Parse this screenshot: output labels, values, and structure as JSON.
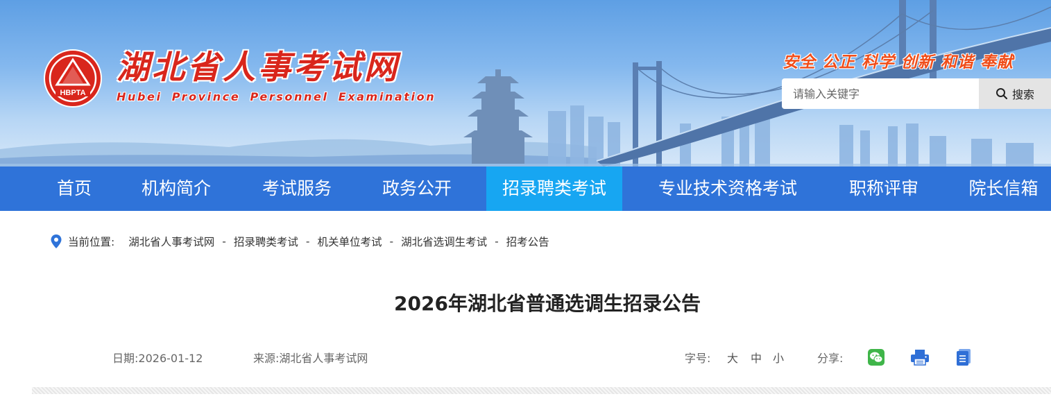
{
  "header": {
    "logo_text": "HBPTA",
    "site_title": "湖北省人事考试网",
    "site_subtitle": "Hubei Province Personnel Examination",
    "slogan": "安全 公正 科学 创新 和谐 奉献"
  },
  "search": {
    "placeholder": "请输入关键字",
    "button_label": "搜索"
  },
  "nav": {
    "items": [
      {
        "label": "首页"
      },
      {
        "label": "机构简介"
      },
      {
        "label": "考试服务"
      },
      {
        "label": "政务公开"
      },
      {
        "label": "招录聘类考试",
        "active": true
      },
      {
        "label": "专业技术资格考试"
      },
      {
        "label": "职称评审"
      },
      {
        "label": "院长信箱"
      }
    ]
  },
  "breadcrumb": {
    "label": "当前位置:",
    "items": [
      "湖北省人事考试网",
      "招录聘类考试",
      "机关单位考试",
      "湖北省选调生考试",
      "招考公告"
    ]
  },
  "article": {
    "title": "2026年湖北省普通选调生招录公告",
    "date_label": "日期:",
    "date": "2026-01-12",
    "source_label": "来源:",
    "source": "湖北省人事考试网",
    "font_size_label": "字号:",
    "font_sizes": [
      "大",
      "中",
      "小"
    ],
    "share_label": "分享:",
    "share_icons": [
      "wechat-icon",
      "print-icon",
      "document-icon"
    ]
  },
  "colors": {
    "nav_bg": "#2f73d9",
    "nav_active": "#17a6f2",
    "brand_red": "#d9261c",
    "slogan_orange": "#f04d1a"
  }
}
